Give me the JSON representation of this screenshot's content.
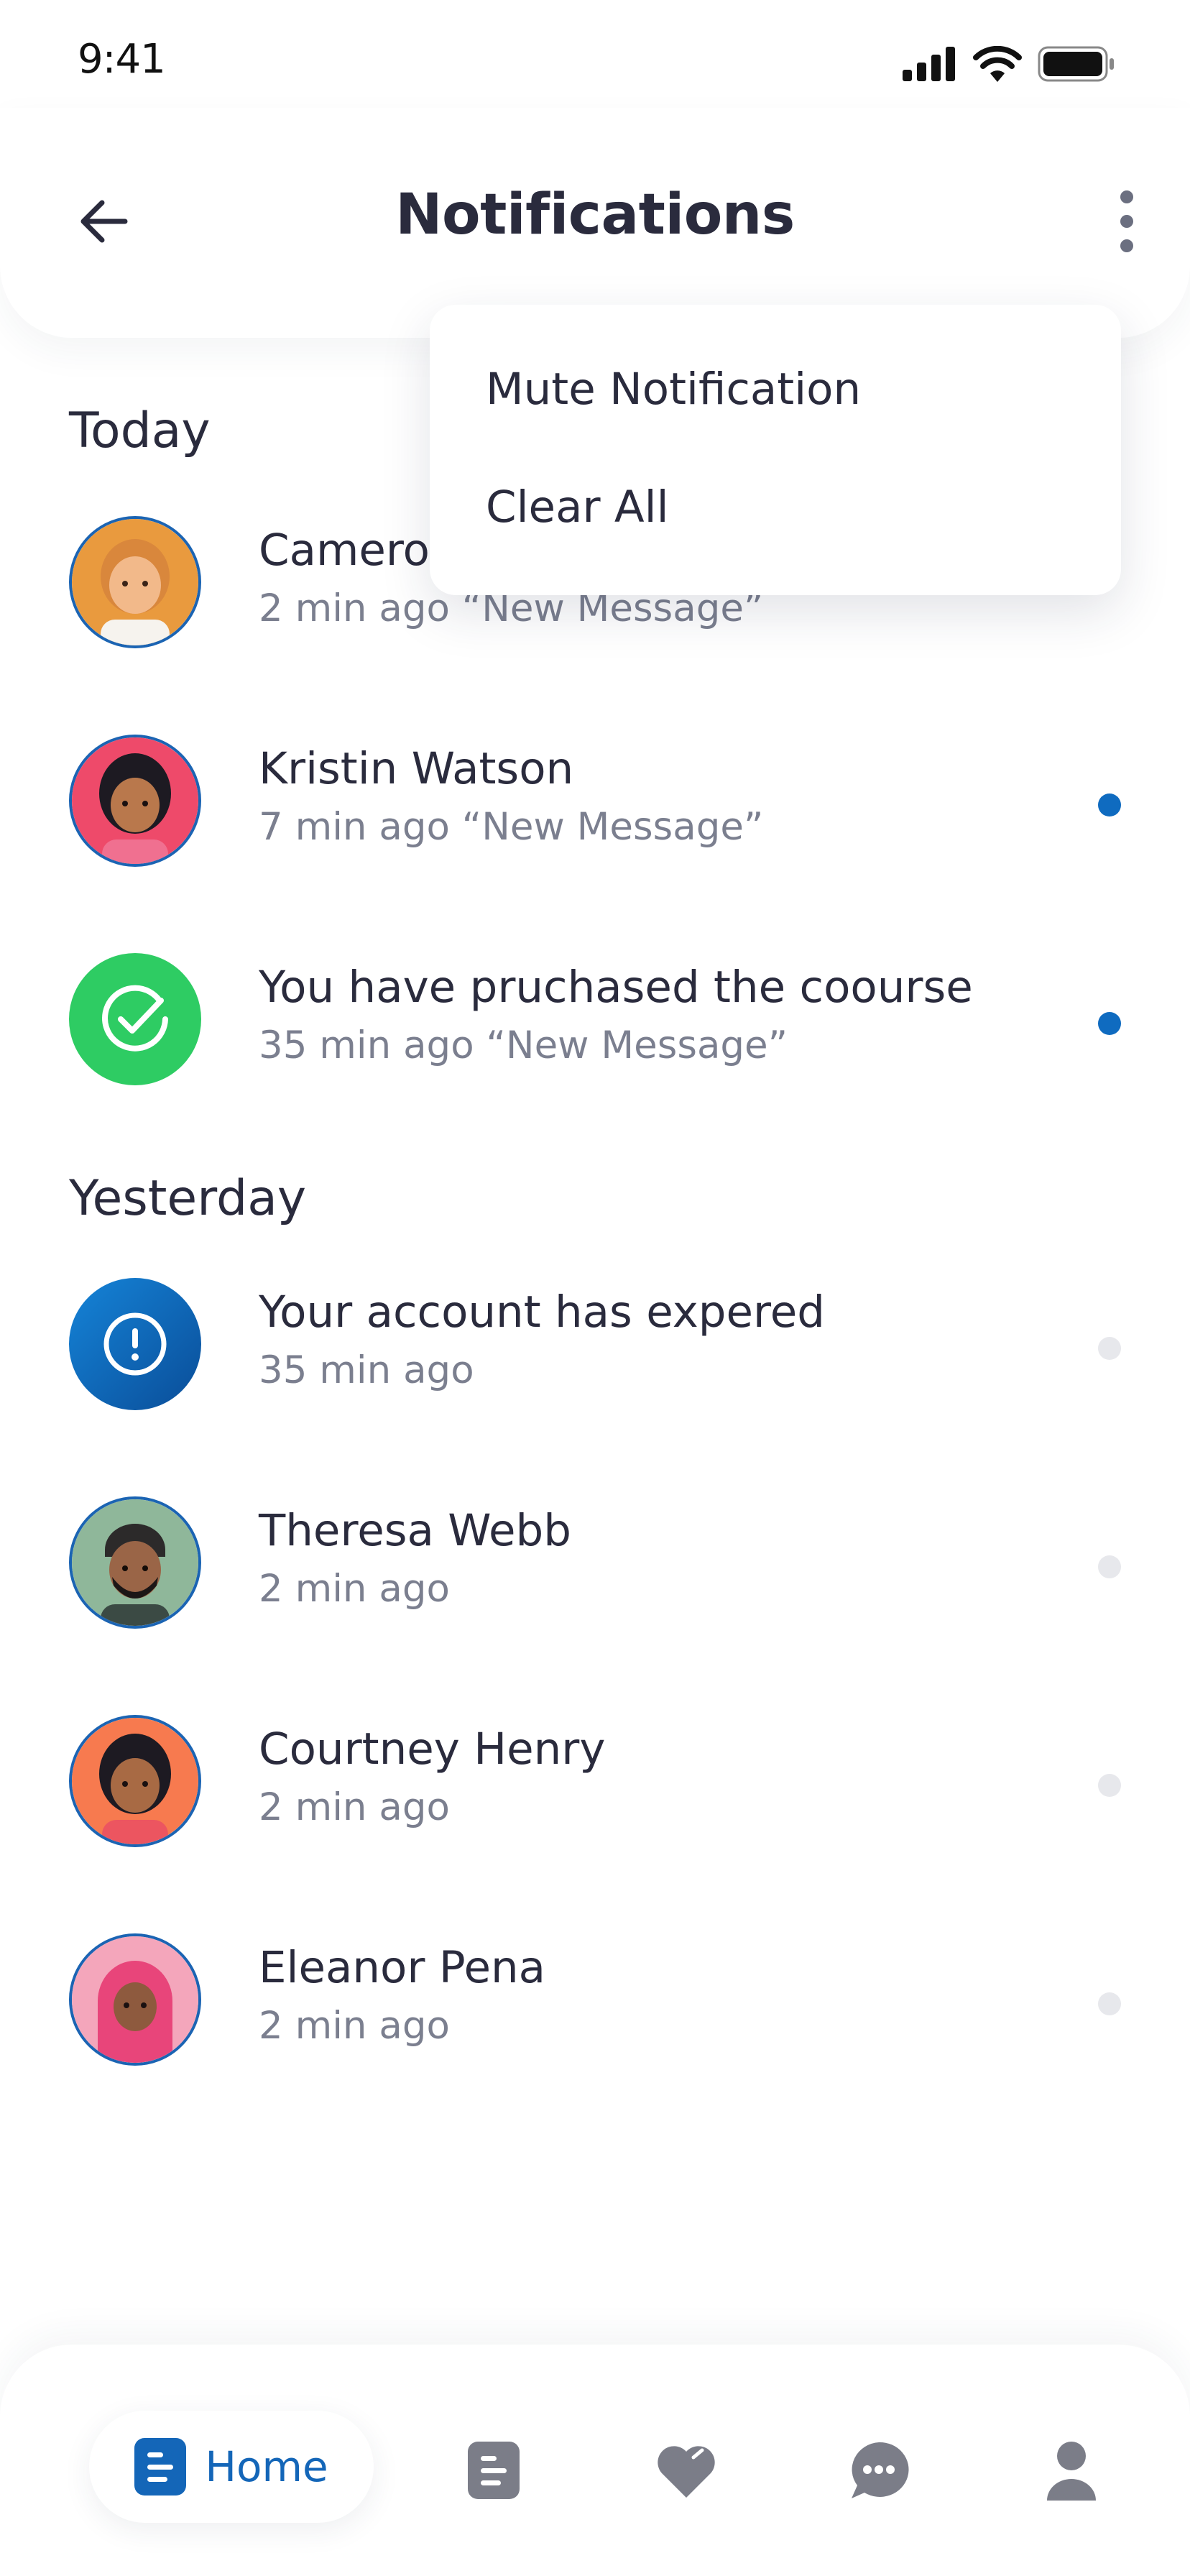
{
  "status_bar": {
    "time": "9:41"
  },
  "header": {
    "title": "Notifications"
  },
  "menu": {
    "items": [
      "Mute Notification",
      "Clear All"
    ]
  },
  "sections": {
    "today": "Today",
    "yesterday": "Yesterday"
  },
  "notifications": [
    {
      "title": "Camero",
      "subtitle": "2 min ago “New Message”",
      "unread": true
    },
    {
      "title": "Kristin Watson",
      "subtitle": "7 min ago “New Message”",
      "unread": true
    },
    {
      "title": "You have pruchased the coourse",
      "subtitle": "35 min ago “New Message”",
      "unread": true
    },
    {
      "title": "Your account has expered",
      "subtitle": "35 min ago",
      "unread": false
    },
    {
      "title": "Theresa Webb",
      "subtitle": "2 min ago",
      "unread": false
    },
    {
      "title": "Courtney Henry",
      "subtitle": "2 min ago",
      "unread": false
    },
    {
      "title": "Eleanor Pena",
      "subtitle": "2 min ago",
      "unread": false
    }
  ],
  "bottom_nav": {
    "home_label": "Home",
    "icons": [
      "home-icon",
      "document-icon",
      "heart-icon",
      "chat-icon",
      "profile-icon"
    ]
  },
  "colors": {
    "accent": "#1466b8",
    "unread_dot": "#0f6bc0",
    "read_dot": "#e7e8ec",
    "success": "#2ecc63",
    "text": "#2a2b3d",
    "muted": "#7b7f8f"
  }
}
